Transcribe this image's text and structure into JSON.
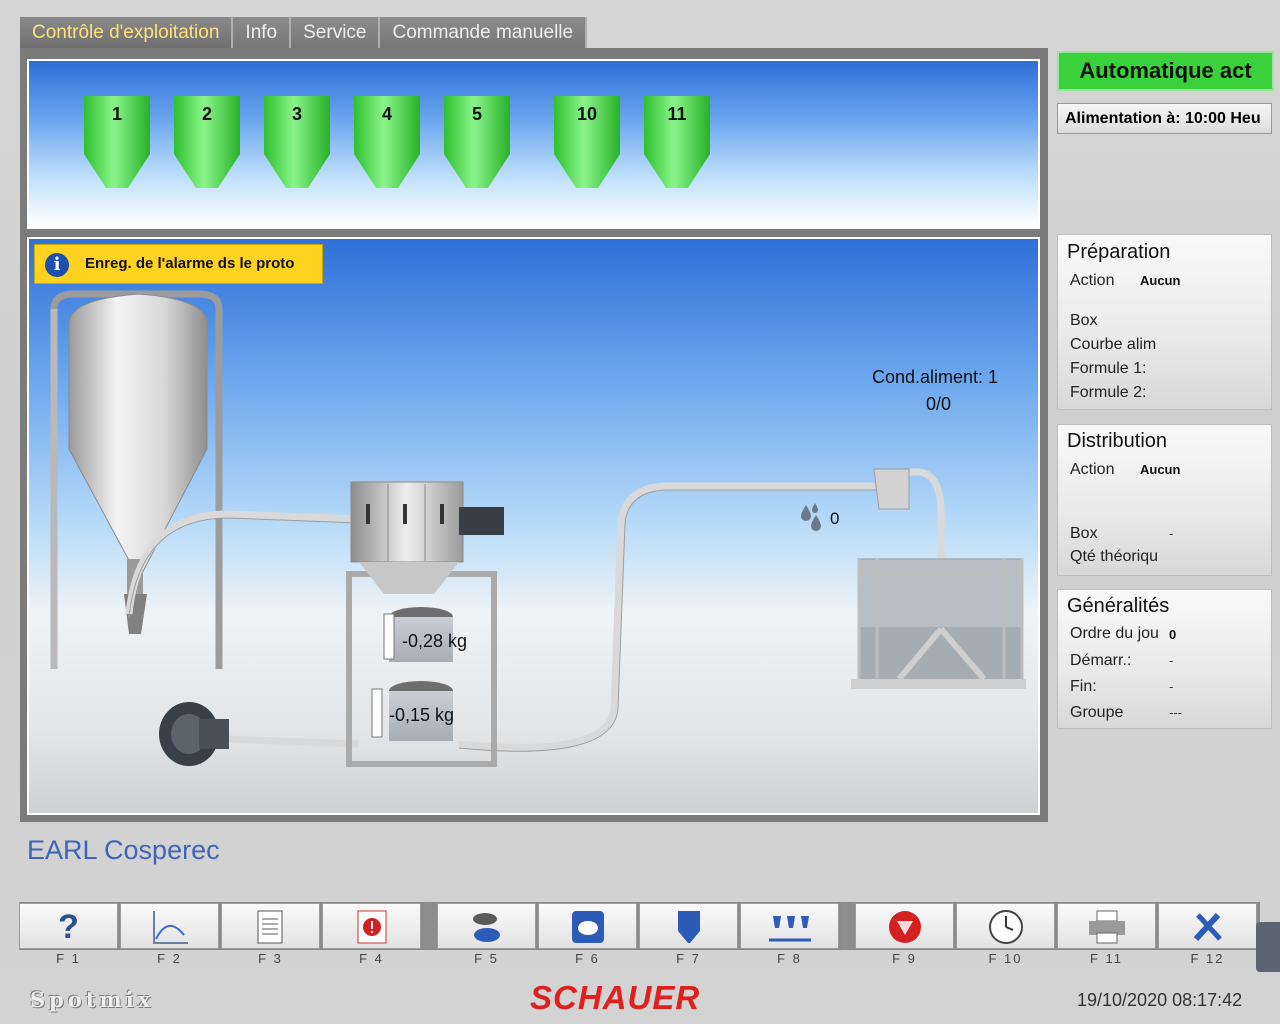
{
  "tabs": [
    {
      "label": "Contrôle d'exploitation",
      "active": true
    },
    {
      "label": "Info"
    },
    {
      "label": "Service"
    },
    {
      "label": "Commande manuelle"
    }
  ],
  "silos": [
    "1",
    "2",
    "3",
    "4",
    "5",
    "10",
    "11"
  ],
  "alarm": {
    "text": "Enreg. de l'alarme ds le proto",
    "icon": "info-icon"
  },
  "scene": {
    "cond_label": "Cond.aliment: 1",
    "cond_value": "0/0",
    "water_value": "0",
    "weight_upper": "-0,28 kg",
    "weight_lower": "-0,15 kg"
  },
  "status": {
    "mode": "Automatique act",
    "feed_button": "Alimentation  à:  10:00 Heu",
    "mode_color": "#3ad13a"
  },
  "preparation": {
    "title": "Préparation",
    "action_label": "Action",
    "action_value": "Aucun",
    "box_label": "Box",
    "curve_label": "Courbe alim",
    "formula1_label": "Formule 1:",
    "formula2_label": "Formule 2:"
  },
  "distribution": {
    "title": "Distribution",
    "action_label": "Action",
    "action_value": "Aucun",
    "box_label": "Box",
    "box_value": "-",
    "qty_label": "Qté théoriqu"
  },
  "general": {
    "title": "Généralités",
    "order_label": "Ordre du jou",
    "order_value": "0",
    "start_label": "Démarr.:",
    "start_value": "-",
    "end_label": "Fin:",
    "end_value": "-",
    "group_label": "Groupe",
    "group_value": "---"
  },
  "farm_name": "EARL Cosperec",
  "fkeys": [
    {
      "label": "F 1",
      "icon": "help-icon"
    },
    {
      "label": "F 2",
      "icon": "curve-icon"
    },
    {
      "label": "F 3",
      "icon": "document-icon"
    },
    {
      "label": "F 4",
      "icon": "alarm-icon"
    },
    {
      "label": "F 5",
      "icon": "pigs-icon"
    },
    {
      "label": "F 6",
      "icon": "feeding-pig-icon"
    },
    {
      "label": "F 7",
      "icon": "silo-icon"
    },
    {
      "label": "F 8",
      "icon": "feeders-icon"
    },
    {
      "label": "F 9",
      "icon": "stop-icon"
    },
    {
      "label": "F 10",
      "icon": "clock-icon"
    },
    {
      "label": "F 11",
      "icon": "printer-icon"
    },
    {
      "label": "F 12",
      "icon": "tools-icon"
    }
  ],
  "footer": {
    "product": "Spotmix",
    "brand": "SCHAUER",
    "datetime": "19/10/2020 08:17:42",
    "brand_color": "#e0201c"
  }
}
